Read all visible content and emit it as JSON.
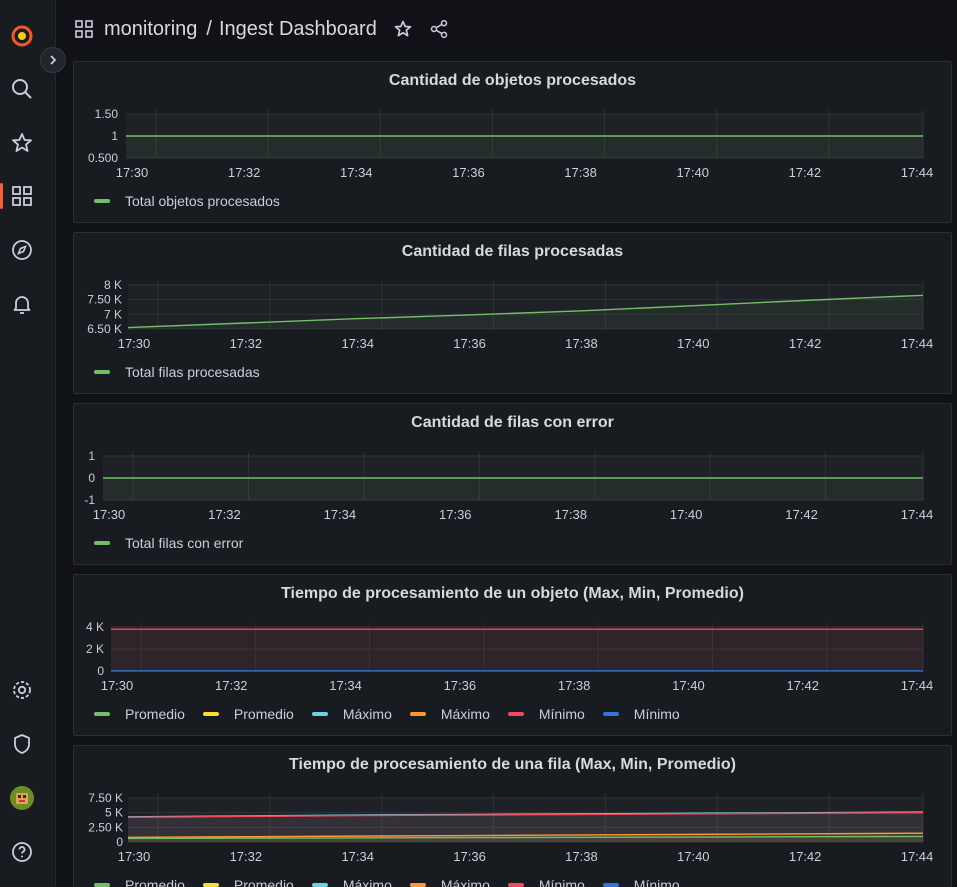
{
  "breadcrumb": {
    "folder": "monitoring",
    "separator": "/",
    "dashboard": "Ingest Dashboard"
  },
  "colors": {
    "green": "#73bf69",
    "yellow": "#fade2a",
    "lightblue": "#5794f2",
    "cyan": "#6ed0e0",
    "orange": "#ff9830",
    "red": "#f2495c",
    "blue": "#3274d9"
  },
  "panels": [
    {
      "title": "Cantidad de objetos procesados",
      "legend": [
        {
          "label": "Total objetos procesados",
          "color": "#73bf69"
        }
      ],
      "chart_data": {
        "type": "line",
        "title": "Cantidad de objetos procesados",
        "x": [
          "17:30",
          "17:32",
          "17:34",
          "17:36",
          "17:38",
          "17:40",
          "17:42",
          "17:44"
        ],
        "y_ticks": [
          "1.50",
          "1",
          "0.500"
        ],
        "ylim": [
          0.5,
          1.5
        ],
        "series": [
          {
            "name": "Total objetos procesados",
            "values": [
              1,
              1,
              1,
              1,
              1,
              1,
              1,
              1
            ]
          }
        ]
      }
    },
    {
      "title": "Cantidad de filas procesadas",
      "legend": [
        {
          "label": "Total filas procesadas",
          "color": "#73bf69"
        }
      ],
      "chart_data": {
        "type": "line",
        "title": "Cantidad de filas procesadas",
        "x": [
          "17:30",
          "17:32",
          "17:34",
          "17:36",
          "17:38",
          "17:40",
          "17:42",
          "17:44"
        ],
        "y_ticks": [
          "8 K",
          "7.50 K",
          "7 K",
          "6.50 K"
        ],
        "ylim": [
          6500,
          8000
        ],
        "series": [
          {
            "name": "Total filas procesadas",
            "values": [
              6550,
              6700,
              6850,
              6980,
              7120,
              7300,
              7480,
              7650
            ]
          }
        ]
      }
    },
    {
      "title": "Cantidad de filas con error",
      "legend": [
        {
          "label": "Total filas con error",
          "color": "#73bf69"
        }
      ],
      "chart_data": {
        "type": "line",
        "title": "Cantidad de filas con error",
        "x": [
          "17:30",
          "17:32",
          "17:34",
          "17:36",
          "17:38",
          "17:40",
          "17:42",
          "17:44"
        ],
        "y_ticks": [
          "1",
          "0",
          "-1"
        ],
        "ylim": [
          -1,
          1
        ],
        "series": [
          {
            "name": "Total filas con error",
            "values": [
              0,
              0,
              0,
              0,
              0,
              0,
              0,
              0
            ]
          }
        ]
      }
    },
    {
      "title": "Tiempo de procesamiento de un objeto (Max, Min, Promedio)",
      "legend": [
        {
          "label": "Promedio",
          "color": "#73bf69"
        },
        {
          "label": "Promedio",
          "color": "#fade2a"
        },
        {
          "label": "Máximo",
          "color": "#6ed0e0"
        },
        {
          "label": "Máximo",
          "color": "#ff9830"
        },
        {
          "label": "Mínimo",
          "color": "#f2495c"
        },
        {
          "label": "Mínimo",
          "color": "#3274d9"
        }
      ],
      "chart_data": {
        "type": "line",
        "title": "Tiempo de procesamiento de un objeto (Max, Min, Promedio)",
        "x": [
          "17:30",
          "17:32",
          "17:34",
          "17:36",
          "17:38",
          "17:40",
          "17:42",
          "17:44"
        ],
        "y_ticks": [
          "4 K",
          "2 K",
          "0"
        ],
        "ylim": [
          0,
          4000
        ],
        "series": [
          {
            "name": "Mínimo",
            "color": "#f2495c",
            "values": [
              3800,
              3800,
              3800,
              3800,
              3800,
              3800,
              3800,
              3800
            ]
          },
          {
            "name": "Mínimo",
            "color": "#3274d9",
            "values": [
              10,
              10,
              10,
              10,
              10,
              10,
              10,
              10
            ]
          }
        ]
      }
    },
    {
      "title": "Tiempo de procesamiento de una fila (Max, Min, Promedio)",
      "legend": [
        {
          "label": "Promedio",
          "color": "#73bf69"
        },
        {
          "label": "Promedio",
          "color": "#fade2a"
        },
        {
          "label": "Máximo",
          "color": "#6ed0e0"
        },
        {
          "label": "Máximo",
          "color": "#ff9830"
        },
        {
          "label": "Mínimo",
          "color": "#f2495c"
        },
        {
          "label": "Mínimo",
          "color": "#3274d9"
        }
      ],
      "chart_data": {
        "type": "line",
        "title": "Tiempo de procesamiento de una fila (Max, Min, Promedio)",
        "x": [
          "17:30",
          "17:32",
          "17:34",
          "17:36",
          "17:38",
          "17:40",
          "17:42",
          "17:44"
        ],
        "y_ticks": [
          "7.50 K",
          "5 K",
          "2.50 K",
          "0"
        ],
        "ylim": [
          0,
          7500
        ],
        "series": [
          {
            "name": "Máximo",
            "color": "#6ed0e0",
            "values": [
              4300,
              4450,
              4600,
              4700,
              4800,
              4900,
              5000,
              5100
            ]
          },
          {
            "name": "Mínimo",
            "color": "#f2495c",
            "values": [
              4200,
              4350,
              4500,
              4600,
              4700,
              4800,
              4900,
              5000
            ]
          },
          {
            "name": "Promedio",
            "color": "#ff9830",
            "values": [
              800,
              900,
              1000,
              1100,
              1200,
              1300,
              1400,
              1500
            ]
          },
          {
            "name": "Promedio",
            "color": "#73bf69",
            "values": [
              600,
              650,
              700,
              750,
              800,
              850,
              900,
              950
            ]
          }
        ]
      }
    }
  ]
}
